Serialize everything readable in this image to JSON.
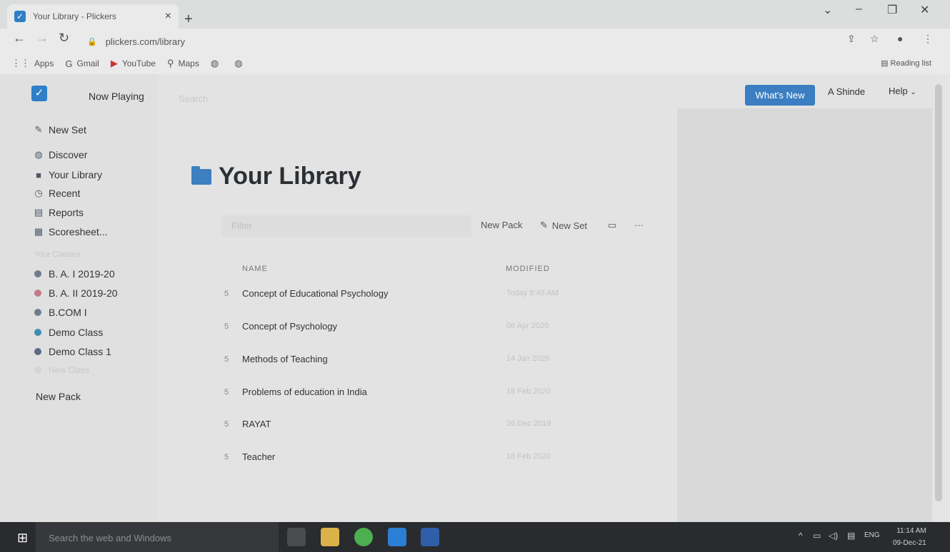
{
  "browser": {
    "tab_title": "Your Library - Plickers",
    "url": "plickers.com/library",
    "bookmarks": [
      "Apps",
      "Gmail",
      "YouTube",
      "Maps"
    ],
    "reading_list": "Reading list"
  },
  "app": {
    "header": {
      "now_playing": "Now Playing",
      "search_placeholder": "Search",
      "whats_new": "What's New",
      "user": "A Shinde",
      "help": "Help"
    },
    "sidebar": {
      "new_set": "New Set",
      "nav": [
        "Discover",
        "Your Library",
        "Recent",
        "Reports",
        "Scoresheet..."
      ],
      "classes_heading": "Your Classes",
      "classes": [
        {
          "label": "B. A. I 2019-20",
          "color": "#6e7c8c"
        },
        {
          "label": "B. A. II 2019-20",
          "color": "#c47a86"
        },
        {
          "label": "B.COM I",
          "color": "#6e7c8c"
        },
        {
          "label": "Demo Class",
          "color": "#3c8fb0"
        },
        {
          "label": "Demo Class 1",
          "color": "#5c6a86"
        }
      ],
      "new_class": "New Class",
      "new_pack": "New Pack"
    },
    "library": {
      "title": "Your Library",
      "filter_placeholder": "Filter",
      "new_pack": "New Pack",
      "new_set": "New Set",
      "col_name": "NAME",
      "col_modified": "MODIFIED",
      "rows": [
        {
          "count": "5",
          "name": "Concept of Educational Psychology",
          "modified": "Today 8:49 AM"
        },
        {
          "count": "5",
          "name": "Concept of Psychology",
          "modified": "06 Apr 2020"
        },
        {
          "count": "5",
          "name": "Methods of Teaching",
          "modified": "14 Jan 2020"
        },
        {
          "count": "5",
          "name": "Problems of education in India",
          "modified": "18 Feb 2020"
        },
        {
          "count": "5",
          "name": "RAYAT",
          "modified": "26 Dec 2019"
        },
        {
          "count": "5",
          "name": "Teacher",
          "modified": "18 Feb 2020"
        }
      ]
    }
  },
  "taskbar": {
    "search_placeholder": "Search the web and Windows",
    "lang": "ENG",
    "time": "11:14 AM",
    "date": "09-Dec-21"
  }
}
